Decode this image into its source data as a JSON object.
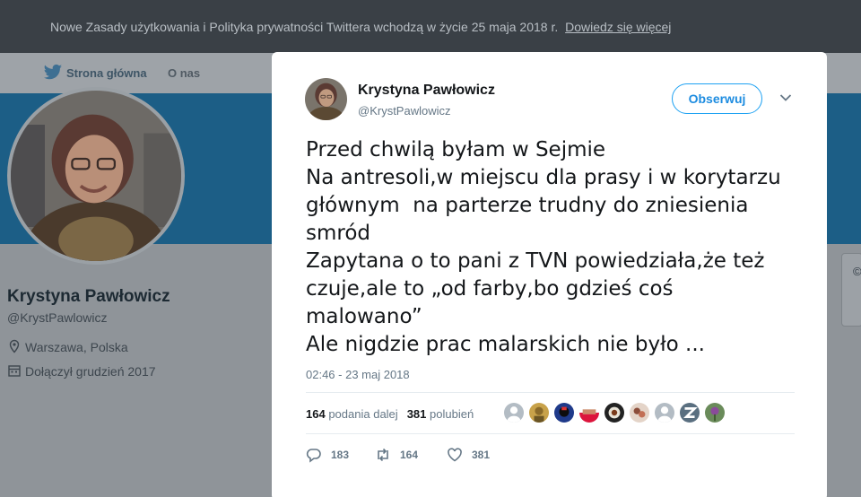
{
  "notice": {
    "text": "Nowe Zasady użytkowania i Polityka prywatności Twittera wchodzą w życie 25 maja 2018 r.",
    "link": "Dowiedz się więcej"
  },
  "nav": {
    "home": "Strona główna",
    "about": "O nas"
  },
  "profile": {
    "name": "Krystyna Pawłowicz",
    "handle": "@KrystPawlowicz",
    "location": "Warszawa, Polska",
    "joined": "Dołączył grudzień 2017"
  },
  "tweet": {
    "author_name": "Krystyna Pawłowicz",
    "author_handle": "@KrystPawlowicz",
    "follow_label": "Obserwuj",
    "lines": [
      "Przed chwilą byłam w Sejmie",
      "Na antresoli,w miejscu dla prasy i w korytarzu",
      "głównym  na parterze trudny do zniesienia",
      "smród",
      "Zapytana o to pani z TVN powiedziała,że też",
      "czuje,ale to „od farby,bo gdzieś coś",
      "malowano”",
      "Ale nigdzie prac malarskich nie było ..."
    ],
    "timestamp": "02:46 - 23 maj 2018",
    "retweets_count": "164",
    "retweets_label": "podania dalej",
    "likes_count": "381",
    "likes_label": "polubień",
    "actions": {
      "reply_count": "183",
      "retweet_count": "164",
      "like_count": "381"
    }
  },
  "colors": {
    "accent": "#1da1f2",
    "text_primary": "#14171a",
    "text_secondary": "#657786",
    "header_bg": "#1c5e86"
  },
  "icons": [
    "twitter-bird-icon",
    "location-pin-icon",
    "calendar-icon",
    "chevron-down-icon",
    "reply-icon",
    "retweet-icon",
    "heart-icon"
  ]
}
